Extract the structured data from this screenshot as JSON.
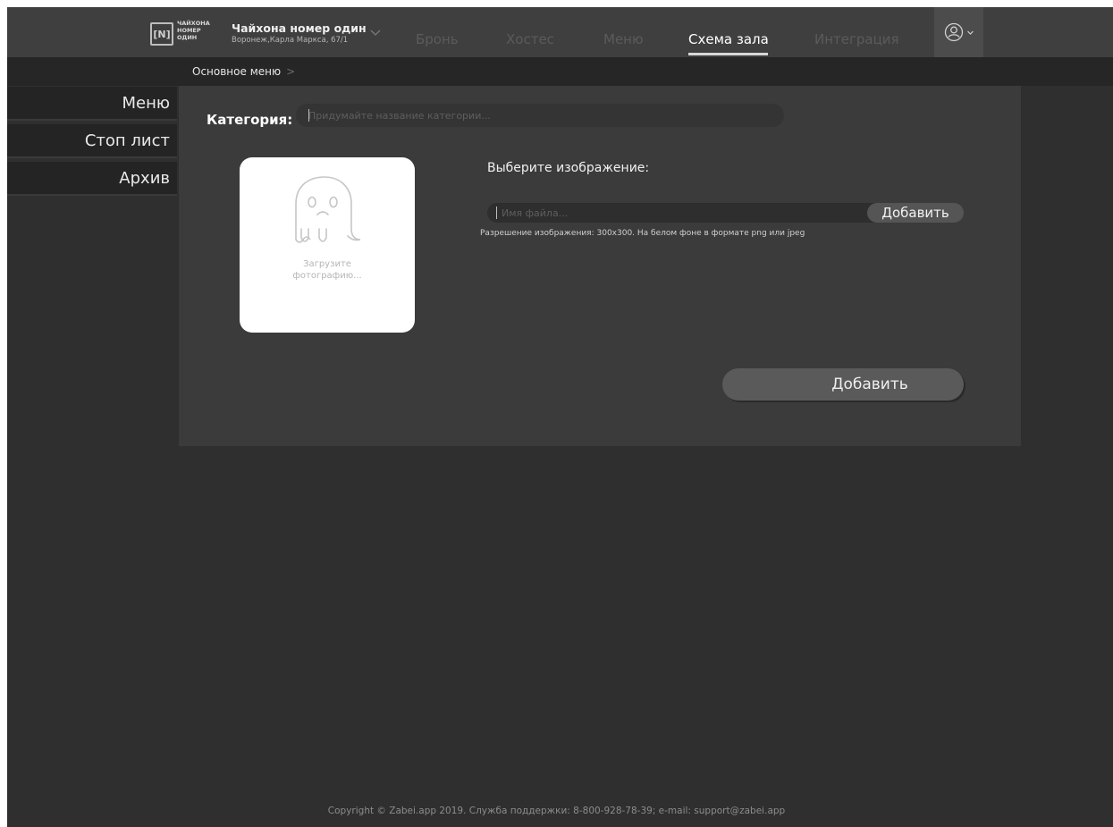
{
  "header": {
    "logo": {
      "mark": "[N]",
      "words": [
        "ЧАЙХОНА",
        "НОМЕР",
        "ОДИН"
      ]
    },
    "venue": {
      "name": "Чайхона номер один",
      "address": "Воронеж,Карла Маркса, 67/1"
    },
    "nav": [
      {
        "label": "Бронь",
        "active": false
      },
      {
        "label": "Хостес",
        "active": false
      },
      {
        "label": "Меню",
        "active": false
      },
      {
        "label": "Схема зала",
        "active": true
      },
      {
        "label": "Интеграция",
        "active": false
      }
    ],
    "user_icon": "user-circle-icon"
  },
  "breadcrumb": {
    "item": "Основное меню",
    "separator": ">"
  },
  "sidebar": {
    "items": [
      {
        "label": "Меню"
      },
      {
        "label": "Стоп лист"
      },
      {
        "label": "Архив"
      }
    ]
  },
  "form": {
    "category_label": "Категория:",
    "category_placeholder": "Придумайте название категории...",
    "photo_placeholder_line1": "Загрузите",
    "photo_placeholder_line2": "фотографию...",
    "photo_icon": "ghost-icon",
    "choose_image_label": "Выберите изображение:",
    "file_placeholder": "Имя файла...",
    "file_add_button": "Добавить",
    "hint": "Разрешение изображения:  300x300. На белом фоне в формате png или jpeg",
    "submit_button": "Добавить"
  },
  "footer": {
    "text": "Copyright © Zabei.app 2019. Служба поддержки: 8-800-928-78-39; e-mail: support@zabei.app"
  },
  "colors": {
    "background": "#2f2f2f",
    "header": "#3f3f3f",
    "panel": "#3b3b3b",
    "sidebar_item": "#242424",
    "nav_inactive": "#5b5b5b"
  }
}
